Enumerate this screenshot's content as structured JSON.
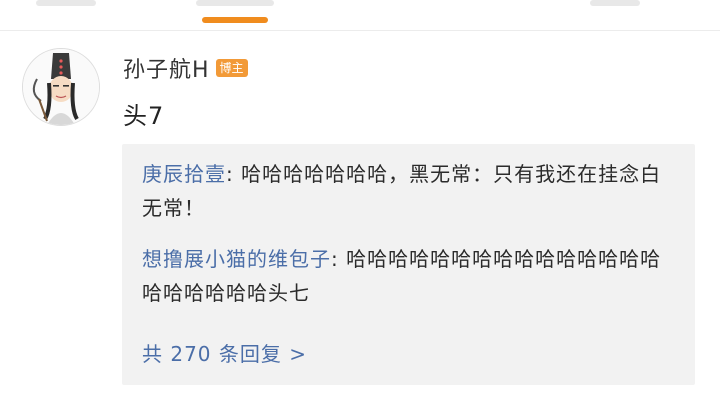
{
  "header": {
    "active_tab_color": "#f08c1e"
  },
  "comment": {
    "author": "孙子航H",
    "author_badge": "博主",
    "text": "头7"
  },
  "replies": [
    {
      "author": "庚辰拾壹",
      "separator": ": ",
      "text": "哈哈哈哈哈哈哈，黑无常：只有我还在挂念白无常！"
    },
    {
      "author": "想撸展小猫的维包子",
      "separator": ": ",
      "text": "哈哈哈哈哈哈哈哈哈哈哈哈哈哈哈哈哈哈哈哈哈头七"
    }
  ],
  "replies_total_label": "共 270 条回复 >",
  "colors": {
    "link": "#4b6ea8",
    "badge": "#f29a38",
    "reply_background": "#f2f2f2"
  }
}
